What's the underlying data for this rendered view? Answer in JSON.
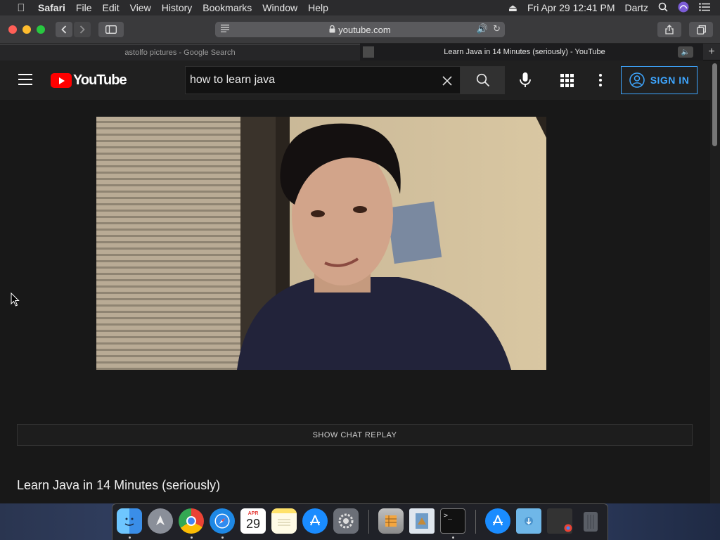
{
  "menubar": {
    "app": "Safari",
    "items": [
      "File",
      "Edit",
      "View",
      "History",
      "Bookmarks",
      "Window",
      "Help"
    ],
    "datetime": "Fri Apr 29  12:41 PM",
    "user": "Dartz"
  },
  "toolbar": {
    "url": "youtube.com"
  },
  "tabs": [
    {
      "title": "astolfo pictures - Google Search"
    },
    {
      "title": "Learn Java in 14 Minutes (seriously) - YouTube"
    }
  ],
  "youtube": {
    "logo_text": "YouTube",
    "search_value": "how to learn java",
    "signin_label": "SIGN IN",
    "chat_replay_label": "SHOW CHAT REPLAY",
    "video_title": "Learn Java in 14 Minutes (seriously)"
  },
  "dock": {
    "calendar_month": "APR",
    "calendar_day": "29",
    "apps": [
      "finder",
      "launchpad",
      "chrome",
      "safari",
      "calendar",
      "notes",
      "app-store",
      "system-preferences",
      "preview",
      "mail-preview",
      "terminal",
      "app-store-2",
      "downloads-folder",
      "chrome-window",
      "trash"
    ]
  },
  "colors": {
    "accent": "#3ea6ff",
    "brand": "#ff0000"
  }
}
